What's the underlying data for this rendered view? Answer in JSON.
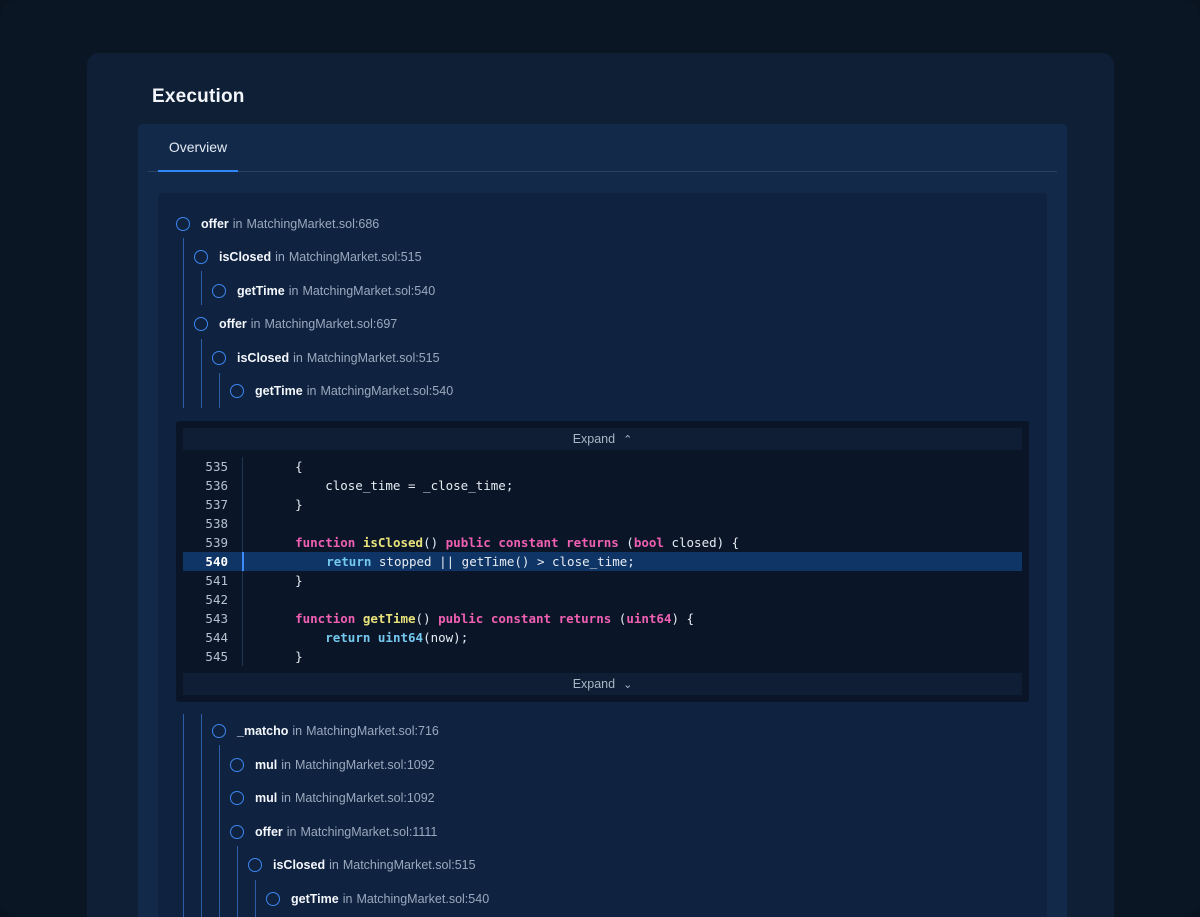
{
  "page": {
    "title": "Execution"
  },
  "tabs": [
    {
      "label": "Overview",
      "active": true
    }
  ],
  "trace_top": [
    {
      "fn": "offer",
      "in": "in",
      "loc": "MatchingMarket.sol:686"
    },
    {
      "fn": "isClosed",
      "in": "in",
      "loc": "MatchingMarket.sol:515"
    },
    {
      "fn": "getTime",
      "in": "in",
      "loc": "MatchingMarket.sol:540"
    },
    {
      "fn": "offer",
      "in": "in",
      "loc": "MatchingMarket.sol:697"
    },
    {
      "fn": "isClosed",
      "in": "in",
      "loc": "MatchingMarket.sol:515"
    },
    {
      "fn": "getTime",
      "in": "in",
      "loc": "MatchingMarket.sol:540"
    }
  ],
  "code": {
    "expand_label": "Expand",
    "active_line": "540",
    "lines": [
      {
        "n": "535",
        "t": "    {"
      },
      {
        "n": "536",
        "t": "        close_time = _close_time;"
      },
      {
        "n": "537",
        "t": "    }"
      },
      {
        "n": "538",
        "t": ""
      },
      {
        "n": "539",
        "t": "    function isClosed() public constant returns (bool closed) {"
      },
      {
        "n": "540",
        "t": "        return stopped || getTime() > close_time;"
      },
      {
        "n": "541",
        "t": "    }"
      },
      {
        "n": "542",
        "t": ""
      },
      {
        "n": "543",
        "t": "    function getTime() public constant returns (uint64) {"
      },
      {
        "n": "544",
        "t": "        return uint64(now);"
      },
      {
        "n": "545",
        "t": "    }"
      }
    ]
  },
  "trace_bottom": [
    {
      "fn": "_matcho",
      "in": "in",
      "loc": "MatchingMarket.sol:716"
    },
    {
      "fn": "mul",
      "in": "in",
      "loc": "MatchingMarket.sol:1092"
    },
    {
      "fn": "mul",
      "in": "in",
      "loc": "MatchingMarket.sol:1092"
    },
    {
      "fn": "offer",
      "in": "in",
      "loc": "MatchingMarket.sol:1111"
    },
    {
      "fn": "isClosed",
      "in": "in",
      "loc": "MatchingMarket.sol:515"
    },
    {
      "fn": "getTime",
      "in": "in",
      "loc": "MatchingMarket.sol:540"
    }
  ],
  "colors": {
    "accent": "#2f86f6",
    "keyword": "#f05fb2",
    "function": "#e9e27b",
    "return": "#74c8ee",
    "highlight": "#0f3566"
  }
}
